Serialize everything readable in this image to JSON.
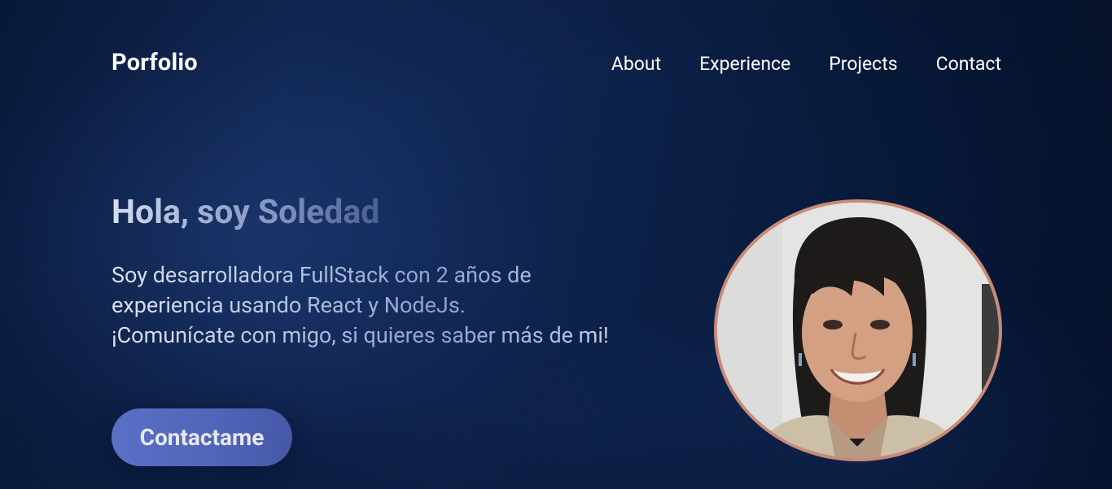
{
  "header": {
    "logo": "Porfolio",
    "nav": [
      {
        "label": "About"
      },
      {
        "label": "Experience"
      },
      {
        "label": "Projects"
      },
      {
        "label": "Contact"
      }
    ]
  },
  "hero": {
    "greeting": "Hola, soy Soledad",
    "intro_lines": [
      "Soy desarrolladora FullStack con 2 años de",
      "experiencia usando React y NodeJs.",
      "¡Comunícate con migo, si quieres saber más de mi!"
    ],
    "cta_label": "Contactame"
  },
  "colors": {
    "background": "#0f2550",
    "cta": "#5064b8",
    "photo_border": "#c98a78"
  }
}
